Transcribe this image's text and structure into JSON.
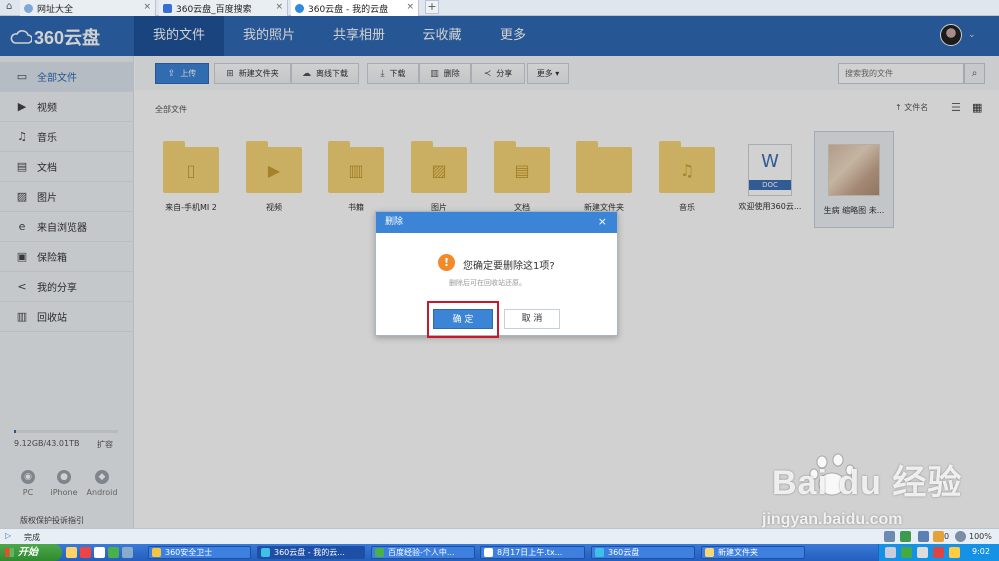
{
  "browser": {
    "tabs": [
      {
        "label": "网址大全",
        "close": "×"
      },
      {
        "label": "360云盘_百度搜索",
        "close": "×"
      },
      {
        "label": "360云盘 - 我的云盘",
        "close": "×"
      }
    ],
    "new_tab": "+"
  },
  "app": {
    "logo_text": "360云盘",
    "nav": [
      "我的文件",
      "我的照片",
      "共享相册",
      "云收藏",
      "更多"
    ],
    "avatar_caret": "⌄"
  },
  "sidebar": {
    "items": [
      {
        "label": "全部文件",
        "icon": "monitor-icon",
        "glyph": "▭"
      },
      {
        "label": "视频",
        "icon": "video-icon",
        "glyph": "▶"
      },
      {
        "label": "音乐",
        "icon": "music-icon",
        "glyph": "♫"
      },
      {
        "label": "文档",
        "icon": "document-icon",
        "glyph": "▤"
      },
      {
        "label": "图片",
        "icon": "image-icon",
        "glyph": "▨"
      },
      {
        "label": "来自浏览器",
        "icon": "browser-icon",
        "glyph": "e"
      },
      {
        "label": "保险箱",
        "icon": "safe-icon",
        "glyph": "▣"
      },
      {
        "label": "我的分享",
        "icon": "share-icon",
        "glyph": "<"
      },
      {
        "label": "回收站",
        "icon": "trash-icon",
        "glyph": "▥"
      }
    ],
    "storage_text": "9.12GB/43.01TB",
    "storage_used_fraction": 0.0002,
    "expand_label": "扩容",
    "downloads": [
      {
        "label": "PC",
        "icon": "pc-icon"
      },
      {
        "label": "iPhone",
        "icon": "apple-icon"
      },
      {
        "label": "Android",
        "icon": "android-icon"
      }
    ],
    "report_link": "版权保护投诉指引"
  },
  "toolbar": {
    "upload": "上传",
    "new_folder": "新建文件夹",
    "offline_download": "离线下载",
    "download": "下载",
    "delete": "删除",
    "share": "分享",
    "more": "更多 ▾",
    "search_placeholder": "搜索我的文件",
    "search_glyph": "⌕"
  },
  "content": {
    "breadcrumb": "全部文件",
    "sort_label": "↑ 文件名",
    "files": [
      {
        "name": "来自-手机MI 2",
        "type": "folder",
        "glyph": "▯"
      },
      {
        "name": "视频",
        "type": "folder",
        "glyph": "▶"
      },
      {
        "name": "书籍",
        "type": "folder",
        "glyph": "▥"
      },
      {
        "name": "图片",
        "type": "folder",
        "glyph": "▨"
      },
      {
        "name": "文档",
        "type": "folder",
        "glyph": "▤"
      },
      {
        "name": "新建文件夹",
        "type": "folder",
        "glyph": ""
      },
      {
        "name": "音乐",
        "type": "folder",
        "glyph": "♫"
      },
      {
        "name": "欢迎使用360云...",
        "type": "doc",
        "glyph": "W",
        "tag": "DOC"
      },
      {
        "name": "生病 缩略图 未...",
        "type": "image"
      }
    ]
  },
  "dialog": {
    "title": "删除",
    "close": "×",
    "message": "您确定要删除这1项?",
    "sub": "删除后可在回收站还原。",
    "confirm": "确 定",
    "cancel": "取 消",
    "warn_glyph": "!"
  },
  "watermark": {
    "logo": "Bai  du 经验",
    "url": "jingyan.baidu.com"
  },
  "statusbar": {
    "text": "完成",
    "zoom": "100%",
    "value": "0"
  },
  "taskbar": {
    "start": "开始",
    "tasks": [
      "360安全卫士",
      "360云盘 - 我的云...",
      "百度经验-个人中...",
      "8月17日上午.tx...",
      "360云盘",
      "新建文件夹"
    ],
    "clock": "9:02"
  },
  "colors": {
    "header": "#2f6ab5",
    "accent": "#3b84d6",
    "folder": "#f7d678",
    "highlight": "#c8192a",
    "warning": "#f28a2a"
  }
}
